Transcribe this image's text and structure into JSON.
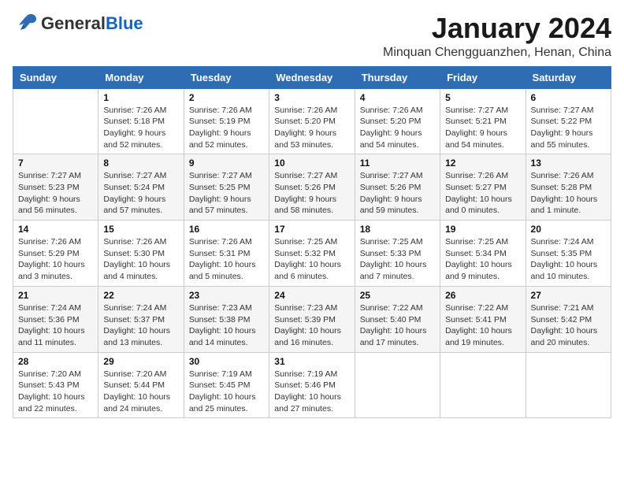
{
  "header": {
    "logo_general": "General",
    "logo_blue": "Blue",
    "month_title": "January 2024",
    "location": "Minquan Chengguanzhen, Henan, China"
  },
  "weekdays": [
    "Sunday",
    "Monday",
    "Tuesday",
    "Wednesday",
    "Thursday",
    "Friday",
    "Saturday"
  ],
  "weeks": [
    [
      {
        "day": "",
        "info": ""
      },
      {
        "day": "1",
        "info": "Sunrise: 7:26 AM\nSunset: 5:18 PM\nDaylight: 9 hours\nand 52 minutes."
      },
      {
        "day": "2",
        "info": "Sunrise: 7:26 AM\nSunset: 5:19 PM\nDaylight: 9 hours\nand 52 minutes."
      },
      {
        "day": "3",
        "info": "Sunrise: 7:26 AM\nSunset: 5:20 PM\nDaylight: 9 hours\nand 53 minutes."
      },
      {
        "day": "4",
        "info": "Sunrise: 7:26 AM\nSunset: 5:20 PM\nDaylight: 9 hours\nand 54 minutes."
      },
      {
        "day": "5",
        "info": "Sunrise: 7:27 AM\nSunset: 5:21 PM\nDaylight: 9 hours\nand 54 minutes."
      },
      {
        "day": "6",
        "info": "Sunrise: 7:27 AM\nSunset: 5:22 PM\nDaylight: 9 hours\nand 55 minutes."
      }
    ],
    [
      {
        "day": "7",
        "info": "Sunrise: 7:27 AM\nSunset: 5:23 PM\nDaylight: 9 hours\nand 56 minutes."
      },
      {
        "day": "8",
        "info": "Sunrise: 7:27 AM\nSunset: 5:24 PM\nDaylight: 9 hours\nand 57 minutes."
      },
      {
        "day": "9",
        "info": "Sunrise: 7:27 AM\nSunset: 5:25 PM\nDaylight: 9 hours\nand 57 minutes."
      },
      {
        "day": "10",
        "info": "Sunrise: 7:27 AM\nSunset: 5:26 PM\nDaylight: 9 hours\nand 58 minutes."
      },
      {
        "day": "11",
        "info": "Sunrise: 7:27 AM\nSunset: 5:26 PM\nDaylight: 9 hours\nand 59 minutes."
      },
      {
        "day": "12",
        "info": "Sunrise: 7:26 AM\nSunset: 5:27 PM\nDaylight: 10 hours\nand 0 minutes."
      },
      {
        "day": "13",
        "info": "Sunrise: 7:26 AM\nSunset: 5:28 PM\nDaylight: 10 hours\nand 1 minute."
      }
    ],
    [
      {
        "day": "14",
        "info": "Sunrise: 7:26 AM\nSunset: 5:29 PM\nDaylight: 10 hours\nand 3 minutes."
      },
      {
        "day": "15",
        "info": "Sunrise: 7:26 AM\nSunset: 5:30 PM\nDaylight: 10 hours\nand 4 minutes."
      },
      {
        "day": "16",
        "info": "Sunrise: 7:26 AM\nSunset: 5:31 PM\nDaylight: 10 hours\nand 5 minutes."
      },
      {
        "day": "17",
        "info": "Sunrise: 7:25 AM\nSunset: 5:32 PM\nDaylight: 10 hours\nand 6 minutes."
      },
      {
        "day": "18",
        "info": "Sunrise: 7:25 AM\nSunset: 5:33 PM\nDaylight: 10 hours\nand 7 minutes."
      },
      {
        "day": "19",
        "info": "Sunrise: 7:25 AM\nSunset: 5:34 PM\nDaylight: 10 hours\nand 9 minutes."
      },
      {
        "day": "20",
        "info": "Sunrise: 7:24 AM\nSunset: 5:35 PM\nDaylight: 10 hours\nand 10 minutes."
      }
    ],
    [
      {
        "day": "21",
        "info": "Sunrise: 7:24 AM\nSunset: 5:36 PM\nDaylight: 10 hours\nand 11 minutes."
      },
      {
        "day": "22",
        "info": "Sunrise: 7:24 AM\nSunset: 5:37 PM\nDaylight: 10 hours\nand 13 minutes."
      },
      {
        "day": "23",
        "info": "Sunrise: 7:23 AM\nSunset: 5:38 PM\nDaylight: 10 hours\nand 14 minutes."
      },
      {
        "day": "24",
        "info": "Sunrise: 7:23 AM\nSunset: 5:39 PM\nDaylight: 10 hours\nand 16 minutes."
      },
      {
        "day": "25",
        "info": "Sunrise: 7:22 AM\nSunset: 5:40 PM\nDaylight: 10 hours\nand 17 minutes."
      },
      {
        "day": "26",
        "info": "Sunrise: 7:22 AM\nSunset: 5:41 PM\nDaylight: 10 hours\nand 19 minutes."
      },
      {
        "day": "27",
        "info": "Sunrise: 7:21 AM\nSunset: 5:42 PM\nDaylight: 10 hours\nand 20 minutes."
      }
    ],
    [
      {
        "day": "28",
        "info": "Sunrise: 7:20 AM\nSunset: 5:43 PM\nDaylight: 10 hours\nand 22 minutes."
      },
      {
        "day": "29",
        "info": "Sunrise: 7:20 AM\nSunset: 5:44 PM\nDaylight: 10 hours\nand 24 minutes."
      },
      {
        "day": "30",
        "info": "Sunrise: 7:19 AM\nSunset: 5:45 PM\nDaylight: 10 hours\nand 25 minutes."
      },
      {
        "day": "31",
        "info": "Sunrise: 7:19 AM\nSunset: 5:46 PM\nDaylight: 10 hours\nand 27 minutes."
      },
      {
        "day": "",
        "info": ""
      },
      {
        "day": "",
        "info": ""
      },
      {
        "day": "",
        "info": ""
      }
    ]
  ]
}
